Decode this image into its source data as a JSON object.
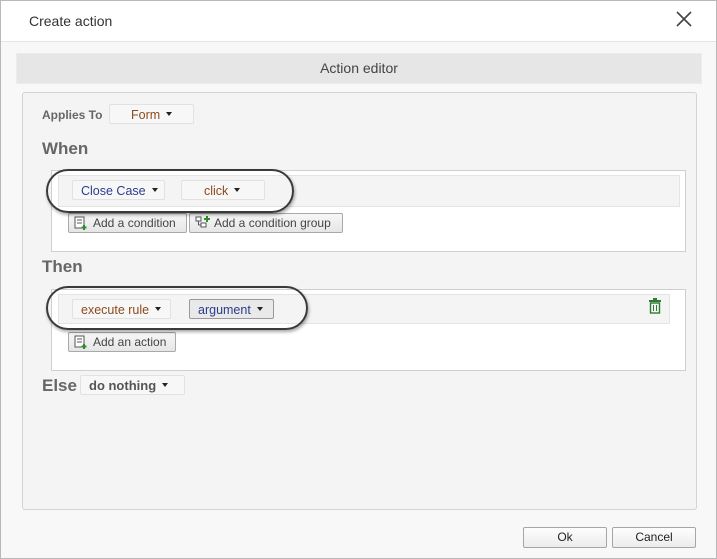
{
  "dialog": {
    "title": "Create action"
  },
  "editor": {
    "header": "Action editor"
  },
  "applies_to": {
    "label": "Applies To",
    "value": "Form"
  },
  "when": {
    "heading": "When",
    "field": "Close Case",
    "event": "click",
    "add_condition": "Add a condition",
    "add_condition_group": "Add a condition group"
  },
  "then": {
    "heading": "Then",
    "action": "execute rule",
    "argument": "argument",
    "add_action": "Add an action"
  },
  "else": {
    "heading": "Else",
    "value": "do nothing"
  },
  "footer": {
    "ok": "Ok",
    "cancel": "Cancel"
  }
}
